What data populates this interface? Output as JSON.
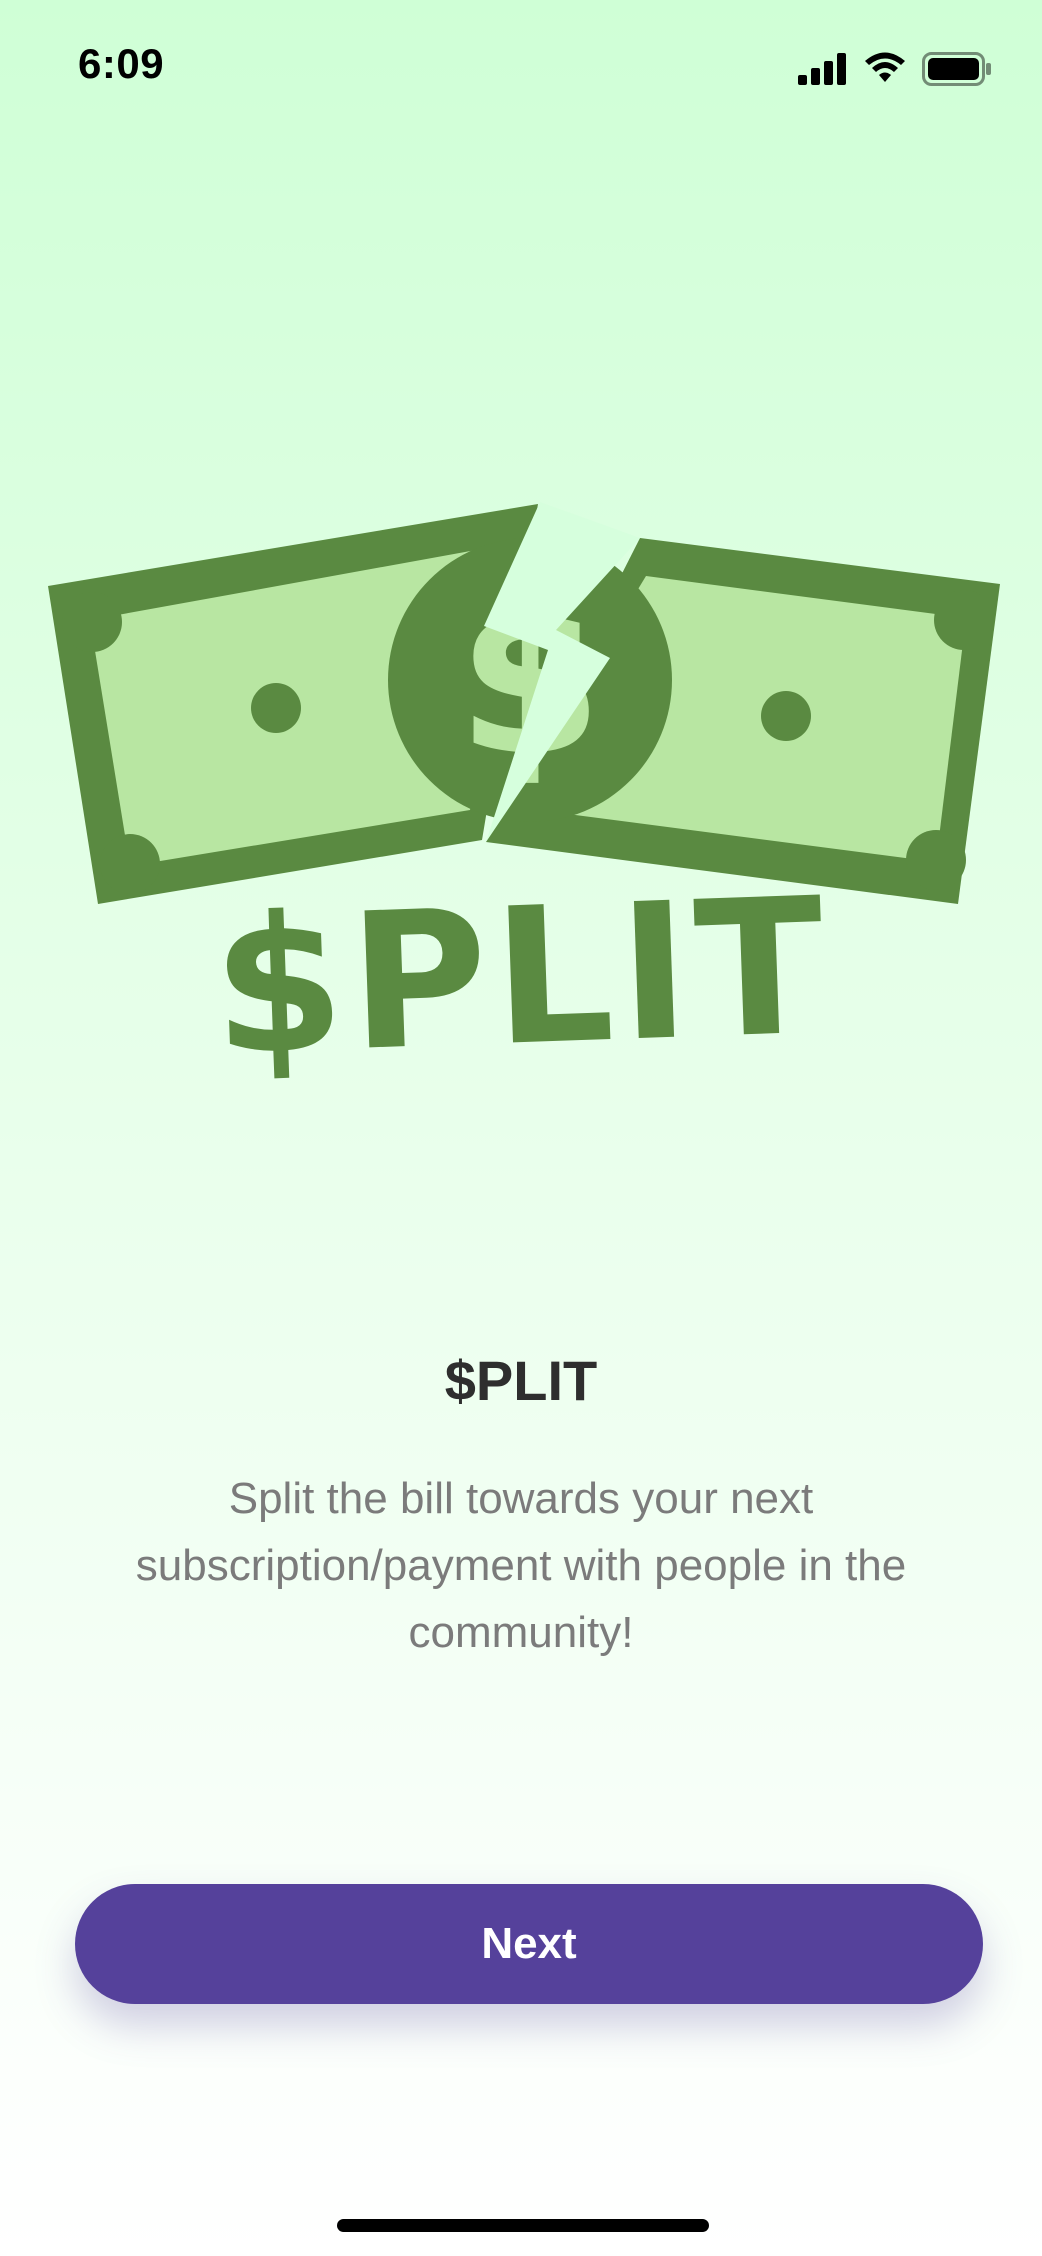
{
  "status_bar": {
    "time": "6:09",
    "icons": [
      "cellular-signal-icon",
      "wifi-icon",
      "battery-icon"
    ]
  },
  "logo": {
    "wordmark": "$PLIT",
    "bill_symbol": "$",
    "colors": {
      "dark_green": "#5a8a41",
      "light_green": "#b8e6a2"
    }
  },
  "content": {
    "title": "$PLIT",
    "description": "Split the bill towards your next subscription/payment with people in the community!"
  },
  "actions": {
    "next_label": "Next"
  },
  "colors": {
    "accent": "#55419b",
    "background_top": "#cfffd6",
    "title_text": "#2e2e2e",
    "body_text": "#7b7b7b"
  }
}
